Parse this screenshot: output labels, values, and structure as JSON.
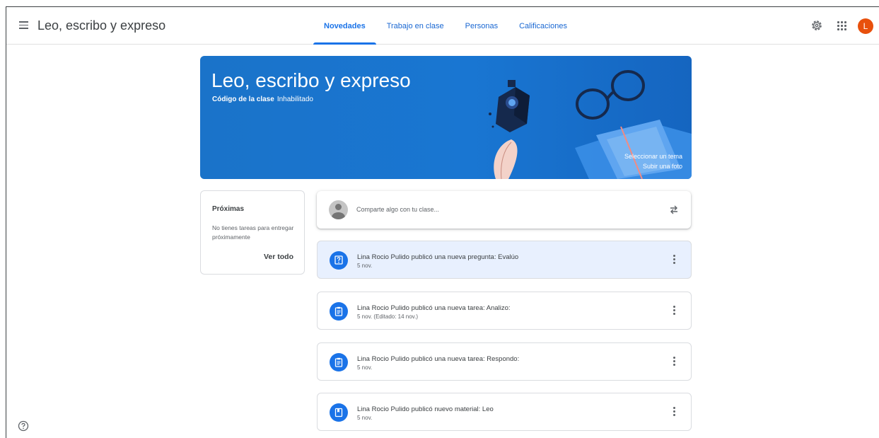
{
  "header": {
    "title": "Leo, escribo y expreso",
    "tabs": [
      {
        "label": "Novedades",
        "active": true
      },
      {
        "label": "Trabajo en clase",
        "active": false
      },
      {
        "label": "Personas",
        "active": false
      },
      {
        "label": "Calificaciones",
        "active": false
      }
    ],
    "avatar_letter": "L",
    "avatar_color": "#e8500c",
    "icons": [
      "menu-icon",
      "settings-icon",
      "apps-grid-icon"
    ]
  },
  "banner": {
    "title": "Leo, escribo y expreso",
    "code_label": "Código de la clase",
    "code_value": "Inhabilitado",
    "select_theme": "Seleccionar un tema",
    "upload_photo": "Subir una foto",
    "color": "#1976d2"
  },
  "upcoming": {
    "title": "Próximas",
    "text": "No tienes tareas para entregar próximamente",
    "link": "Ver todo"
  },
  "share": {
    "placeholder": "Comparte algo con tu clase..."
  },
  "posts": [
    {
      "icon": "question-icon",
      "title": "Lina Rocio Pulido publicó una nueva pregunta: Evalúo",
      "date": "5 nov."
    },
    {
      "icon": "assignment-icon",
      "title": "Lina Rocio Pulido publicó una nueva tarea: Analizo:",
      "date": "5 nov. (Editado: 14 nov.)"
    },
    {
      "icon": "assignment-icon",
      "title": "Lina Rocio Pulido publicó una nueva tarea: Respondo:",
      "date": "5 nov."
    },
    {
      "icon": "material-icon",
      "title": "Lina Rocio Pulido publicó nuevo material: Leo",
      "date": "5 nov."
    }
  ],
  "accent_color": "#1a73e8"
}
